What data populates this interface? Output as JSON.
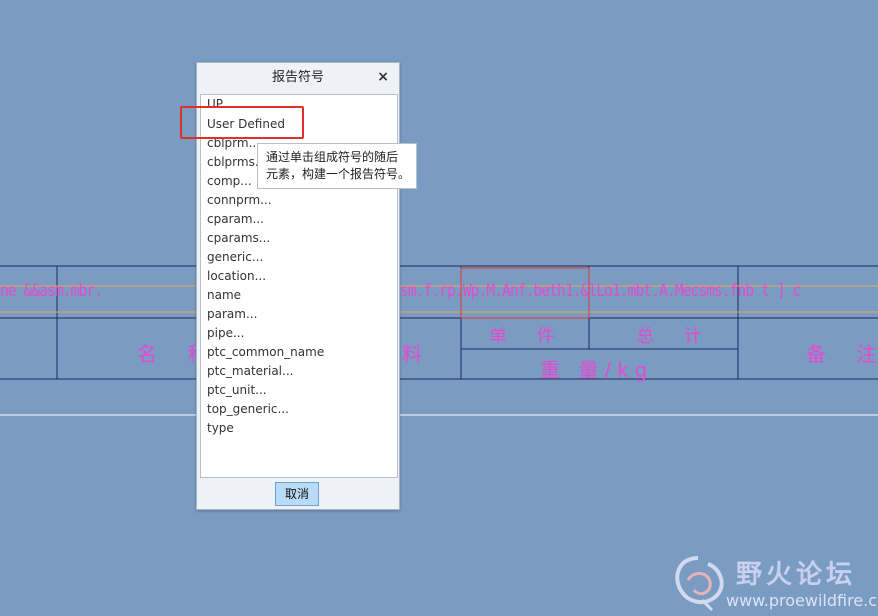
{
  "dialog": {
    "title": "报告符号",
    "close": "×",
    "items": [
      "UP..",
      "User Defined",
      "cblprm...",
      "cblprms...",
      "comp...",
      "connprm...",
      "cparam...",
      "cparams...",
      "generic...",
      "location...",
      "name",
      "param...",
      "pipe...",
      "ptc_common_name",
      "ptc_material...",
      "ptc_unit...",
      "top_generic...",
      "type"
    ],
    "cancel_label": "取消"
  },
  "tooltip": {
    "line1": "通过单击组成符号的随后",
    "line2": "元素，构建一个报告符号。"
  },
  "drawing": {
    "param_text_left": "ne &&asm.mbr.",
    "param_text_mid": "sm.f.rp.Wp.M.Anf.beth1.&lLo1.mbt.A.Mecsms.fnb t ] c",
    "col_name": "名 称",
    "col_material": "料",
    "col_unit": "单 件",
    "col_total": "总 计",
    "col_weight": "重 量/kg",
    "col_remark": "备 注"
  },
  "watermark": {
    "title": "野火论坛",
    "url": "www.proewildfire.cn"
  }
}
